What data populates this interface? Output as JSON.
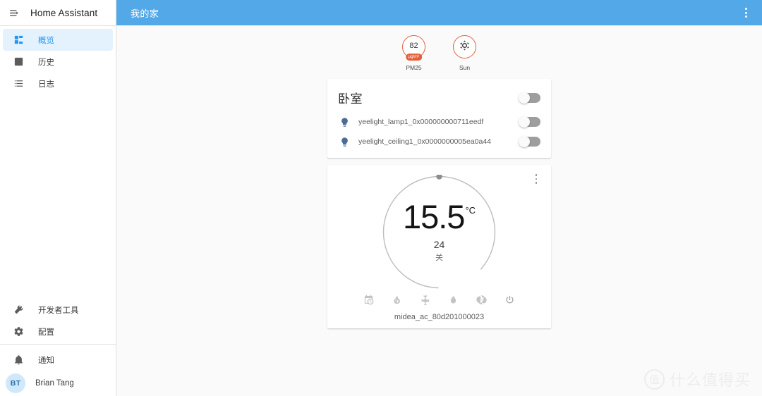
{
  "sidebar": {
    "app_title": "Home Assistant",
    "hamburger_icon": "menu-open-icon",
    "items": [
      {
        "label": "概览",
        "icon": "view-dashboard-icon",
        "active": true
      },
      {
        "label": "历史",
        "icon": "chart-box-icon",
        "active": false
      },
      {
        "label": "日志",
        "icon": "format-list-bulleted-icon",
        "active": false
      }
    ],
    "bottom_items": [
      {
        "label": "开发者工具",
        "icon": "hammer-wrench-icon"
      },
      {
        "label": "配置",
        "icon": "cog-icon"
      }
    ],
    "footer_items": [
      {
        "label": "通知",
        "icon": "bell-icon"
      }
    ],
    "user": {
      "name": "Brian Tang",
      "initials": "BT"
    }
  },
  "header": {
    "title": "我的家",
    "menu_icon": "dots-vertical-icon"
  },
  "badges": [
    {
      "name": "PM25",
      "value": "82",
      "unit": "µg/m³",
      "icon": "",
      "accent": "#e2603c"
    },
    {
      "name": "Sun",
      "value": "",
      "unit": "",
      "icon": "weather-sunny-icon",
      "accent": "#e2603c"
    }
  ],
  "entities_card": {
    "title": "卧室",
    "header_toggle_state": "off",
    "rows": [
      {
        "icon": "lightbulb-icon",
        "name": "yeelight_lamp1_0x000000000711eedf",
        "toggle_state": "off"
      },
      {
        "icon": "lightbulb-icon",
        "name": "yeelight_ceiling1_0x0000000005ea0a44",
        "toggle_state": "off"
      }
    ]
  },
  "thermostat_card": {
    "menu_icon": "dots-vertical-icon",
    "target_temperature": "15.5",
    "unit": "°C",
    "current_temperature": "24",
    "state": "关",
    "entity_name": "midea_ac_80d201000023",
    "dial_handle_angle_deg": 0,
    "modes": [
      {
        "icon": "calendar-clock-icon",
        "name": "auto"
      },
      {
        "icon": "fire-icon",
        "name": "heat"
      },
      {
        "icon": "snowflake-icon",
        "name": "cool"
      },
      {
        "icon": "water-percent-icon",
        "name": "dry"
      },
      {
        "icon": "fan-icon",
        "name": "fan-only"
      },
      {
        "icon": "power-icon",
        "name": "off"
      }
    ]
  },
  "watermark": {
    "logo_char": "值",
    "text": "什么值得买"
  },
  "colors": {
    "header_blue": "#53a9e8",
    "accent_blue": "#2196f3",
    "active_bg": "#e3f2fd",
    "badge_orange": "#e2603c",
    "bulb_blue": "#4c6b96",
    "page_bg": "#fafafa"
  }
}
